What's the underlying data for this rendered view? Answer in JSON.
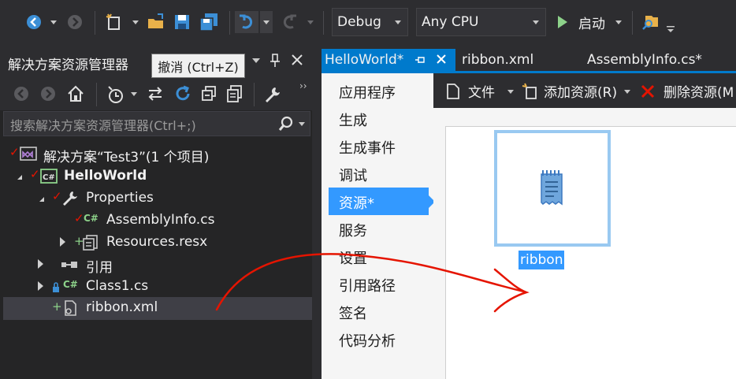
{
  "toolbar": {
    "config": "Debug",
    "platform": "Any CPU",
    "start_label": "启动",
    "accent_blue": "#007acc",
    "start_green": "#8dd28a"
  },
  "solution_explorer": {
    "title": "解决方案资源管理器",
    "tooltip": "撤消 (Ctrl+Z)",
    "search_placeholder": "搜索解决方案资源管理器(Ctrl+;)",
    "tree": [
      {
        "label": "解决方案“Test3”(1 个项目)",
        "icon": "solution-icon"
      },
      {
        "label": "HelloWorld",
        "icon": "csharp-project-icon"
      },
      {
        "label": "Properties",
        "icon": "wrench-icon"
      },
      {
        "label": "AssemblyInfo.cs",
        "icon": "csharp-file-icon"
      },
      {
        "label": "Resources.resx",
        "icon": "resx-file-icon"
      },
      {
        "label": "引用",
        "icon": "references-icon"
      },
      {
        "label": "Class1.cs",
        "icon": "csharp-file-icon"
      },
      {
        "label": "ribbon.xml",
        "icon": "xml-file-icon"
      }
    ]
  },
  "tabs": [
    {
      "label": "HelloWorld*",
      "active": true
    },
    {
      "label": "ribbon.xml",
      "active": false
    },
    {
      "label": "AssemblyInfo.cs*",
      "active": false
    }
  ],
  "properties": {
    "nav": [
      "应用程序",
      "生成",
      "生成事件",
      "调试",
      "资源*",
      "服务",
      "设置",
      "引用路径",
      "签名",
      "代码分析"
    ],
    "selected_index": 4,
    "resource_toolbar": {
      "file": "文件",
      "add": "添加资源(R)",
      "remove": "删除资源(M"
    },
    "resource_item": "ribbon"
  },
  "annotation_color": "#e51400"
}
